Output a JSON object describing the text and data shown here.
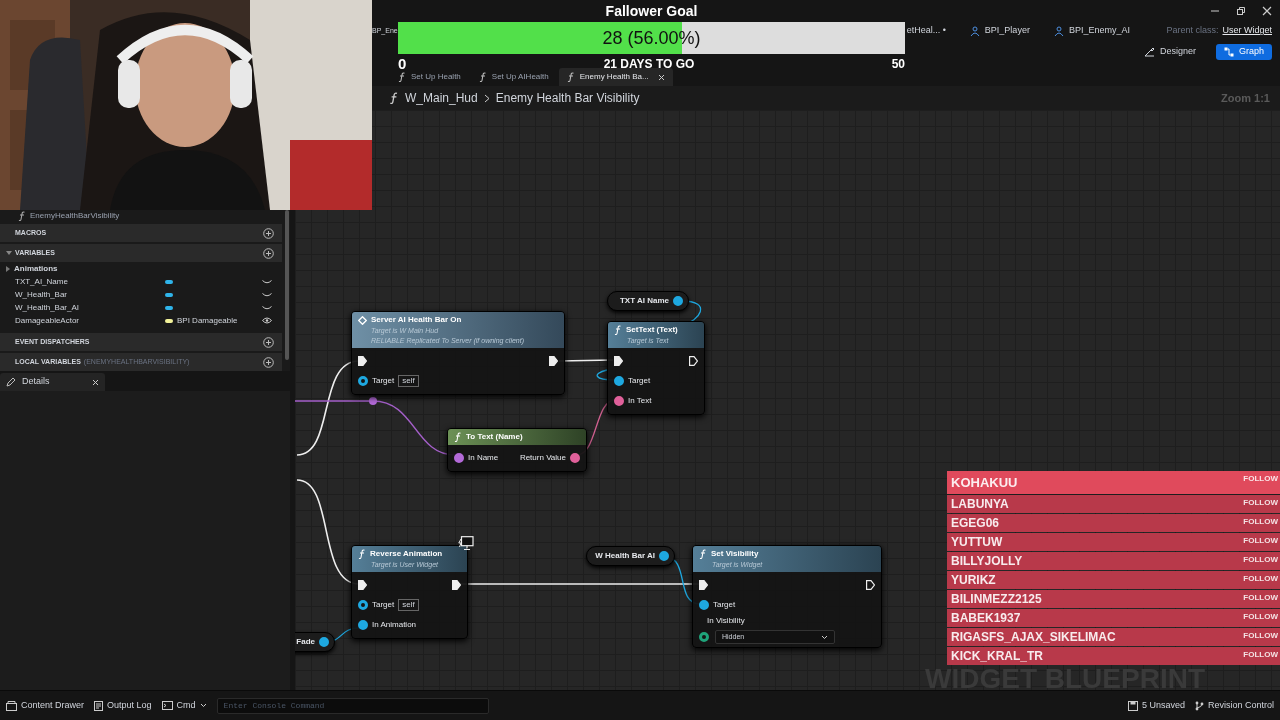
{
  "webcam": {
    "kind": "picture"
  },
  "asset_tabs": [
    {
      "label": "BP_Ene",
      "icon": false
    },
    {
      "label": "etHeal... •",
      "icon": false
    },
    {
      "label": "BPI_Player",
      "icon": true
    },
    {
      "label": "BPI_Enemy_AI",
      "icon": true
    }
  ],
  "parent_class": {
    "label": "Parent class:",
    "value": "User Widget"
  },
  "modes": [
    {
      "label": "Designer",
      "selected": false
    },
    {
      "label": "Graph",
      "selected": true
    }
  ],
  "graph_tabs": [
    {
      "label": "Set Up Health",
      "selected": false
    },
    {
      "label": "Set Up AIHealth",
      "selected": false
    },
    {
      "label": "Enemy Health Ba...",
      "selected": true
    }
  ],
  "goal": {
    "title": "Fallower Goal",
    "level": 0.56,
    "reading": "28 (56.00%)",
    "min": "0",
    "remaining": "21 DAYS TO GO",
    "max": "50"
  },
  "breadcrumb": [
    "W_Main_Hud",
    "Enemy Health Bar Visibility"
  ],
  "zoom": "Zoom 1:1",
  "my_blueprint": {
    "function_item": "EnemyHealthBarVisibility",
    "macros": "MACROS",
    "variables": {
      "label": "VARIABLES",
      "expanded": true,
      "categories": [
        {
          "label": "Animations",
          "expanded": false
        }
      ],
      "items": [
        {
          "name": "TXT_AI_Name",
          "color": "#2fb4ea",
          "public": false
        },
        {
          "name": "W_Health_Bar",
          "color": "#2fb4ea",
          "public": false
        },
        {
          "name": "W_Health_Bar_AI",
          "color": "#2fb4ea",
          "public": false
        },
        {
          "name": "DamageableActor",
          "color": "#f2f29a",
          "type": "BPI Damageable",
          "public": true
        }
      ]
    },
    "event_dispatchers": "EVENT DISPATCHERS",
    "local_variables": {
      "label": "LOCAL VARIABLES",
      "scope": "(ENEMYHEALTHBARVISIBILITY)"
    }
  },
  "details_tab": {
    "label": "Details"
  },
  "nodes": [
    {
      "kind": "event",
      "title": "Server AI Health Bar On",
      "subtitles": [
        "Target is W Main Hud",
        "RELIABLE Replicated To Server (if owning client)"
      ],
      "rows": [
        {
          "in": {
            "kind": "exec",
            "connected": true
          },
          "out": {
            "kind": "exec",
            "connected": true
          }
        },
        {
          "in": {
            "kind": "data",
            "label": "Target",
            "color": "#1ea8e0",
            "connected": false,
            "default": "self"
          }
        }
      ]
    },
    {
      "kind": "variable",
      "title": "TXT AI Name",
      "rows": [
        {
          "out": {
            "kind": "data",
            "color": "#1ea8e0",
            "connected": true
          }
        }
      ]
    },
    {
      "kind": "function",
      "title": "SetText (Text)",
      "subtitles": [
        "Target is Text"
      ],
      "rows": [
        {
          "in": {
            "kind": "exec",
            "connected": true
          },
          "out": {
            "kind": "exec",
            "connected": false
          }
        },
        {
          "in": {
            "kind": "data",
            "label": "Target",
            "color": "#1ea8e0",
            "connected": true
          }
        },
        {
          "in": {
            "kind": "data",
            "label": "In Text",
            "color": "#e0609a",
            "connected": true
          }
        }
      ]
    },
    {
      "kind": "pure",
      "title": "To Text (Name)",
      "rows": [
        {
          "in": {
            "kind": "data",
            "label": "In Name",
            "color": "#b36ad8",
            "connected": true
          },
          "out": {
            "kind": "data",
            "label": "Return Value",
            "color": "#e0609a",
            "connected": true
          }
        }
      ]
    },
    {
      "kind": "function",
      "title": "Reverse Animation",
      "subtitles": [
        "Target is User Widget"
      ],
      "rows": [
        {
          "in": {
            "kind": "exec",
            "connected": true
          },
          "out": {
            "kind": "exec",
            "connected": true
          }
        },
        {
          "in": {
            "kind": "data",
            "label": "Target",
            "color": "#1ea8e0",
            "connected": false,
            "default": "self"
          }
        },
        {
          "in": {
            "kind": "data",
            "label": "In Animation",
            "color": "#1ea8e0",
            "connected": true
          }
        }
      ]
    },
    {
      "kind": "variable",
      "title": "W Health Bar AI",
      "rows": [
        {
          "out": {
            "kind": "data",
            "color": "#1ea8e0",
            "connected": true
          }
        }
      ]
    },
    {
      "kind": "function",
      "title": "Set Visibility",
      "subtitles": [
        "Target is Widget"
      ],
      "rows": [
        {
          "in": {
            "kind": "exec",
            "connected": true
          },
          "out": {
            "kind": "exec",
            "connected": false
          }
        },
        {
          "in": {
            "kind": "data",
            "label": "Target",
            "color": "#1ea8e0",
            "connected": true
          }
        },
        {
          "in": {
            "kind": "enum",
            "label": "In Visibility",
            "color": "#1fa37a",
            "connected": false,
            "value": "Hidden"
          }
        }
      ]
    },
    {
      "kind": "variable",
      "title": "Fade",
      "rows": [
        {
          "out": {
            "kind": "data",
            "color": "#1ea8e0",
            "connected": true
          }
        }
      ]
    }
  ],
  "followers": [
    {
      "name": "KOHAKUU",
      "action": "FOLLOW",
      "highlighted": true
    },
    {
      "name": "LABUNYA",
      "action": "FOLLOW",
      "highlighted": false
    },
    {
      "name": "EGEG06",
      "action": "FOLLOW",
      "highlighted": false
    },
    {
      "name": "YUTTUW",
      "action": "FOLLOW",
      "highlighted": false
    },
    {
      "name": "BILLYJOLLY",
      "action": "FOLLOW",
      "highlighted": false
    },
    {
      "name": "YURIKZ",
      "action": "FOLLOW",
      "highlighted": false
    },
    {
      "name": "BILINMEZZ2125",
      "action": "FOLLOW",
      "highlighted": false
    },
    {
      "name": "BABEK1937",
      "action": "FOLLOW",
      "highlighted": false
    },
    {
      "name": "RIGASFS_AJAX_SIKELIMAC",
      "action": "FOLLOW",
      "highlighted": false
    },
    {
      "name": "KICK_KRAL_TR",
      "action": "FOLLOW",
      "highlighted": false
    }
  ],
  "graph_watermark": "WIDGET BLUEPRINT",
  "status_bar": {
    "content_drawer": "Content Drawer",
    "output_log": "Output Log",
    "cmd": "Cmd",
    "console": {
      "placeholder": "Enter Console Command"
    },
    "unsaved": "5 Unsaved",
    "revision": "Revision Control"
  }
}
